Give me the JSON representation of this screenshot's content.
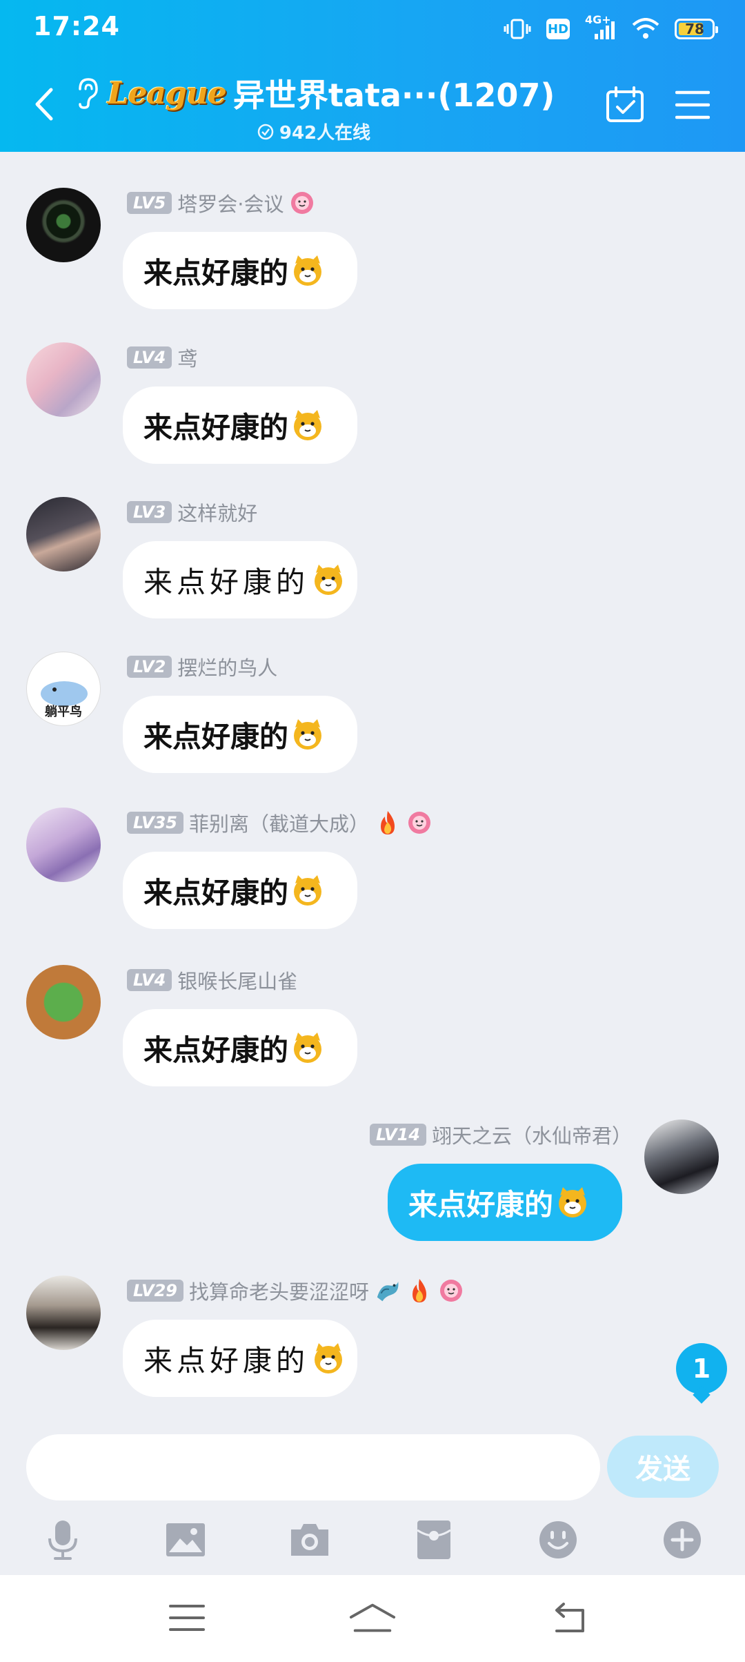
{
  "status_bar": {
    "time": "17:24",
    "network": "4G+",
    "hd": "HD",
    "battery": "78",
    "battery_level": 0.78
  },
  "header": {
    "group_logo": "League",
    "title": "异世界tata···(1207)",
    "online": "942人在线"
  },
  "messages": [
    {
      "level": "LV5",
      "name": "塔罗会·会议",
      "text": "来点好康的",
      "style": "bold",
      "self": false,
      "badges": [
        "flower-badge-icon"
      ]
    },
    {
      "level": "LV4",
      "name": "鸢",
      "text": "来点好康的",
      "style": "bold",
      "self": false,
      "badges": []
    },
    {
      "level": "LV3",
      "name": "这样就好",
      "text": "来点好康的",
      "style": "handwriting",
      "self": false,
      "badges": []
    },
    {
      "level": "LV2",
      "name": "摆烂的鸟人",
      "text": "来点好康的",
      "style": "bold",
      "self": false,
      "badges": [],
      "avatar_text": "躺平鸟"
    },
    {
      "level": "LV35",
      "name": "菲别离（截道大成）",
      "text": "来点好康的",
      "style": "bold",
      "self": false,
      "badges": [
        "fire-badge-icon",
        "flower-badge-icon"
      ]
    },
    {
      "level": "LV4",
      "name": "银喉长尾山雀",
      "text": "来点好康的",
      "style": "bold",
      "self": false,
      "badges": []
    },
    {
      "level": "LV14",
      "name": "翊天之云（水仙帝君）",
      "text": "来点好康的",
      "style": "bold",
      "self": true,
      "badges": []
    },
    {
      "level": "LV29",
      "name": "找算命老头要涩涩呀",
      "text": "来点好康的",
      "style": "handwriting",
      "self": false,
      "badges": [
        "dragon-badge-icon",
        "fire-badge-icon",
        "flower-badge-icon"
      ]
    }
  ],
  "unread_count": "1",
  "input": {
    "placeholder": "",
    "value": "",
    "send_label": "发送"
  },
  "colors": {
    "header": "#17a6f3",
    "self_bubble": "#1ebaf4",
    "level_badge": "#b5bac5",
    "send_disabled": "#bfe9fb"
  }
}
